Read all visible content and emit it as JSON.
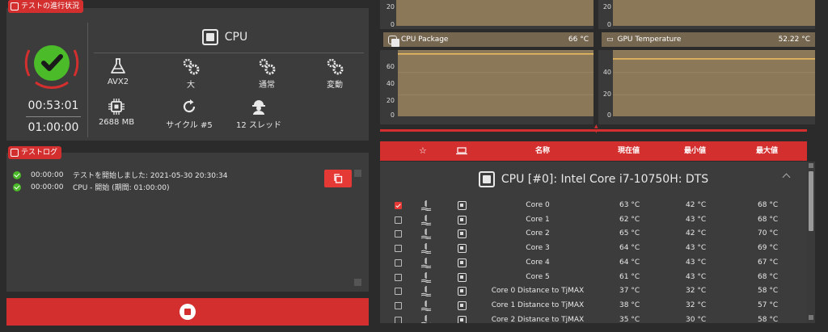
{
  "status": {
    "tag_label": "テストの進行状況",
    "elapsed": "00:53:01",
    "total": "01:00:00",
    "title": "CPU",
    "stats": [
      {
        "icon": "flask-icon",
        "label": "AVX2"
      },
      {
        "icon": "gears-icon",
        "label": "大"
      },
      {
        "icon": "gears-icon",
        "label": "通常"
      },
      {
        "icon": "gears-icon",
        "label": "変動"
      },
      {
        "icon": "chip-icon",
        "label": "2688 MB"
      },
      {
        "icon": "refresh-icon",
        "label": "サイクル #5"
      },
      {
        "icon": "worker-icon",
        "label": "12 スレッド"
      }
    ]
  },
  "log": {
    "tag_label": "テストログ",
    "entries": [
      {
        "time": "00:00:00",
        "text": "テストを開始しました: 2021-05-30 20:30:34"
      },
      {
        "time": "00:00:00",
        "text": "CPU - 開始 (期間: 01:00:00)"
      }
    ]
  },
  "charts": [
    {
      "name": "CPU Package",
      "value": "66 °C",
      "icon": "chip-icon",
      "y_ticks": [
        "60",
        "40",
        "20",
        "0"
      ],
      "top_ticks": [
        "20",
        "0"
      ]
    },
    {
      "name": "GPU Temperature",
      "value": "52.22 °C",
      "icon": "gpu-icon",
      "y_ticks": [
        "40",
        "20",
        "0"
      ],
      "top_ticks": [
        "20",
        "0"
      ]
    }
  ],
  "chart_data": [
    {
      "type": "line",
      "title": "CPU Package",
      "ylim": [
        0,
        70
      ],
      "series": [
        {
          "values": [
            66,
            66,
            66,
            66,
            66,
            66,
            66,
            66,
            66,
            66
          ]
        }
      ]
    },
    {
      "type": "line",
      "title": "GPU Temperature",
      "ylim": [
        0,
        60
      ],
      "series": [
        {
          "values": [
            52,
            52,
            52,
            52,
            52,
            52,
            52,
            52,
            52,
            52
          ]
        }
      ]
    }
  ],
  "table": {
    "headers": {
      "name": "名称",
      "current": "現在値",
      "min": "最小値",
      "max": "最大値"
    },
    "group_title": "CPU [#0]: Intel Core i7-10750H: DTS",
    "rows": [
      {
        "checked": true,
        "name": "Core 0",
        "current": "63 °C",
        "min": "42 °C",
        "max": "68 °C"
      },
      {
        "checked": false,
        "name": "Core 1",
        "current": "62 °C",
        "min": "43 °C",
        "max": "68 °C"
      },
      {
        "checked": false,
        "name": "Core 2",
        "current": "65 °C",
        "min": "42 °C",
        "max": "70 °C"
      },
      {
        "checked": false,
        "name": "Core 3",
        "current": "64 °C",
        "min": "43 °C",
        "max": "69 °C"
      },
      {
        "checked": false,
        "name": "Core 4",
        "current": "64 °C",
        "min": "43 °C",
        "max": "67 °C"
      },
      {
        "checked": false,
        "name": "Core 5",
        "current": "61 °C",
        "min": "43 °C",
        "max": "68 °C"
      },
      {
        "checked": false,
        "name": "Core 0 Distance to TjMAX",
        "current": "37 °C",
        "min": "32 °C",
        "max": "58 °C"
      },
      {
        "checked": false,
        "name": "Core 1 Distance to TjMAX",
        "current": "38 °C",
        "min": "32 °C",
        "max": "57 °C"
      },
      {
        "checked": false,
        "name": "Core 2 Distance to TjMAX",
        "current": "35 °C",
        "min": "30 °C",
        "max": "58 °C"
      }
    ]
  },
  "colors": {
    "accent": "#d32f2f",
    "success": "#4cbb2a",
    "chart_fill": "#8a7858",
    "chart_line": "#f0c060"
  }
}
